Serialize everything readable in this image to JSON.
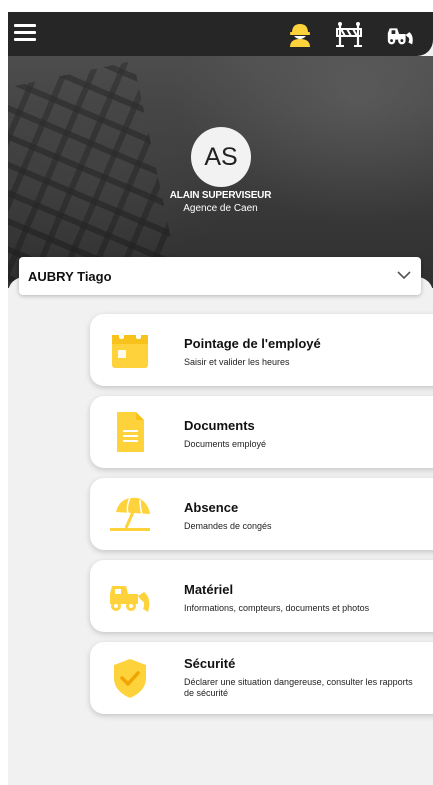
{
  "header": {
    "menu_icon": "hamburger-menu-icon",
    "icons": [
      "worker-helmet-icon",
      "road-barrier-icon",
      "excavator-icon"
    ],
    "accent_color": "#fdd23a"
  },
  "profile": {
    "initials": "AS",
    "name": "ALAIN SUPERVISEUR",
    "agency": "Agence de Caen"
  },
  "employee_select": {
    "value": "AUBRY Tiago",
    "icon": "chevron-down-icon"
  },
  "menu": [
    {
      "title": "Pointage de l'employé",
      "subtitle": "Saisir et valider les heures",
      "icon": "calendar-icon"
    },
    {
      "title": "Documents",
      "subtitle": "Documents employé",
      "icon": "document-icon"
    },
    {
      "title": "Absence",
      "subtitle": "Demandes de congés",
      "icon": "beach-umbrella-icon"
    },
    {
      "title": "Matériel",
      "subtitle": "Informations, compteurs, documents et photos",
      "icon": "excavator-icon"
    },
    {
      "title": "Sécurité",
      "subtitle": "Déclarer une situation dangereuse, consulter les rapports de sécurité",
      "icon": "shield-check-icon"
    }
  ]
}
